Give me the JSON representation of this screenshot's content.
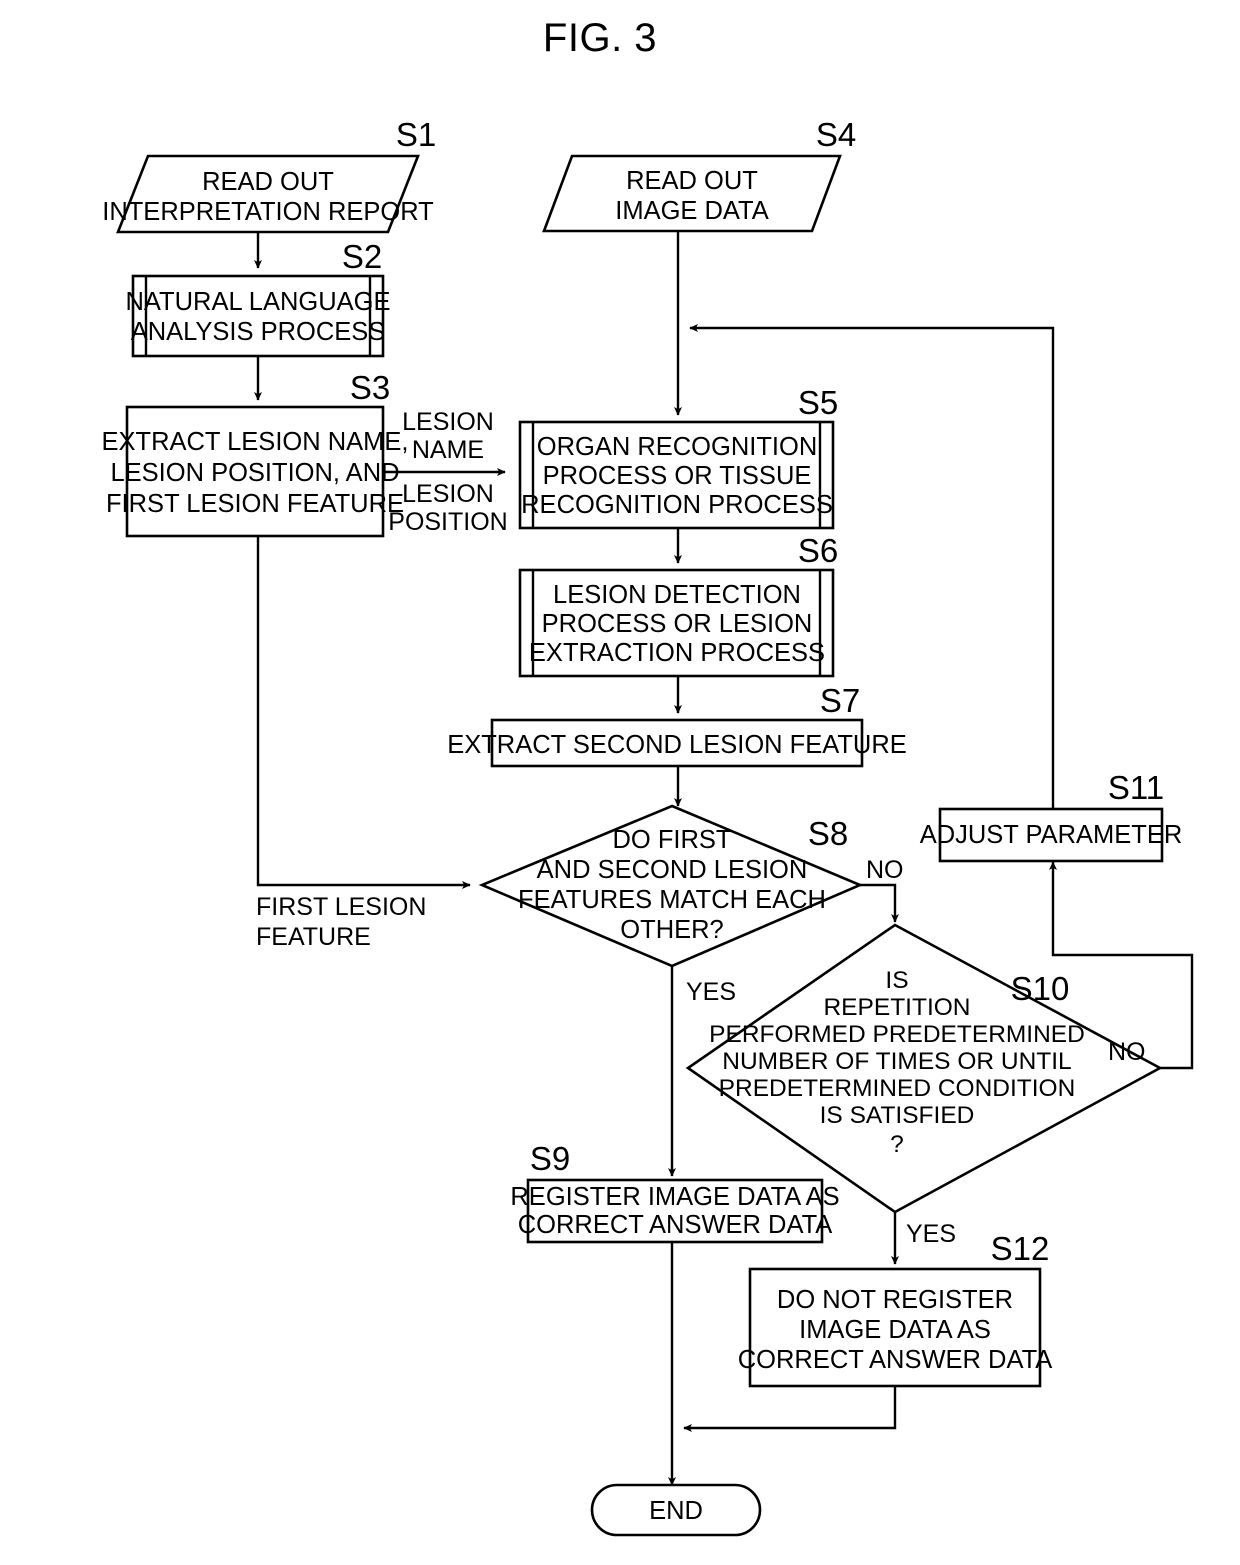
{
  "figure": {
    "title": "FIG. 3",
    "domain": "patent-flowchart"
  },
  "nodes": {
    "s1": {
      "step": "S1",
      "shape": "parallelogram",
      "lines": [
        "READ OUT",
        "INTERPRETATION REPORT"
      ]
    },
    "s2": {
      "step": "S2",
      "shape": "predefined-process",
      "lines": [
        "NATURAL LANGUAGE",
        "ANALYSIS PROCESS"
      ]
    },
    "s3": {
      "step": "S3",
      "shape": "process",
      "lines": [
        "EXTRACT LESION NAME,",
        "LESION POSITION, AND",
        "FIRST LESION FEATURE"
      ]
    },
    "s4": {
      "step": "S4",
      "shape": "parallelogram",
      "lines": [
        "READ OUT",
        "IMAGE DATA"
      ]
    },
    "s5": {
      "step": "S5",
      "shape": "predefined-process",
      "lines": [
        "ORGAN RECOGNITION",
        "PROCESS OR TISSUE",
        "RECOGNITION PROCESS"
      ]
    },
    "s6": {
      "step": "S6",
      "shape": "predefined-process",
      "lines": [
        "LESION DETECTION",
        "PROCESS OR LESION",
        "EXTRACTION PROCESS"
      ]
    },
    "s7": {
      "step": "S7",
      "shape": "process",
      "lines": [
        "EXTRACT SECOND LESION FEATURE"
      ]
    },
    "s8": {
      "step": "S8",
      "shape": "decision",
      "lines": [
        "DO FIRST",
        "AND SECOND LESION",
        "FEATURES MATCH EACH",
        "OTHER?"
      ]
    },
    "s9": {
      "step": "S9",
      "shape": "process",
      "lines": [
        "REGISTER IMAGE DATA AS",
        "CORRECT ANSWER DATA"
      ]
    },
    "s10": {
      "step": "S10",
      "shape": "decision",
      "lines": [
        "IS",
        "REPETITION",
        "PERFORMED PREDETERMINED",
        "NUMBER OF TIMES OR UNTIL",
        "PREDETERMINED CONDITION",
        "IS SATISFIED",
        "?"
      ]
    },
    "s11": {
      "step": "S11",
      "shape": "process",
      "lines": [
        "ADJUST PARAMETER"
      ]
    },
    "s12": {
      "step": "S12",
      "shape": "process",
      "lines": [
        "DO NOT REGISTER",
        "IMAGE DATA AS",
        "CORRECT ANSWER DATA"
      ]
    },
    "end": {
      "step": "",
      "shape": "terminator",
      "lines": [
        "END"
      ]
    }
  },
  "edge_labels": {
    "lesion_name": "LESION",
    "lesion_name2": "NAME",
    "lesion_position": "LESION",
    "lesion_position2": "POSITION",
    "first_lesion_feature": "FIRST LESION",
    "first_lesion_feature2": "FEATURE",
    "s8_no": "NO",
    "s8_yes": "YES",
    "s10_no": "NO",
    "s10_yes": "YES"
  },
  "colors": {
    "stroke": "#000000",
    "fill": "#ffffff",
    "background": "#ffffff"
  }
}
